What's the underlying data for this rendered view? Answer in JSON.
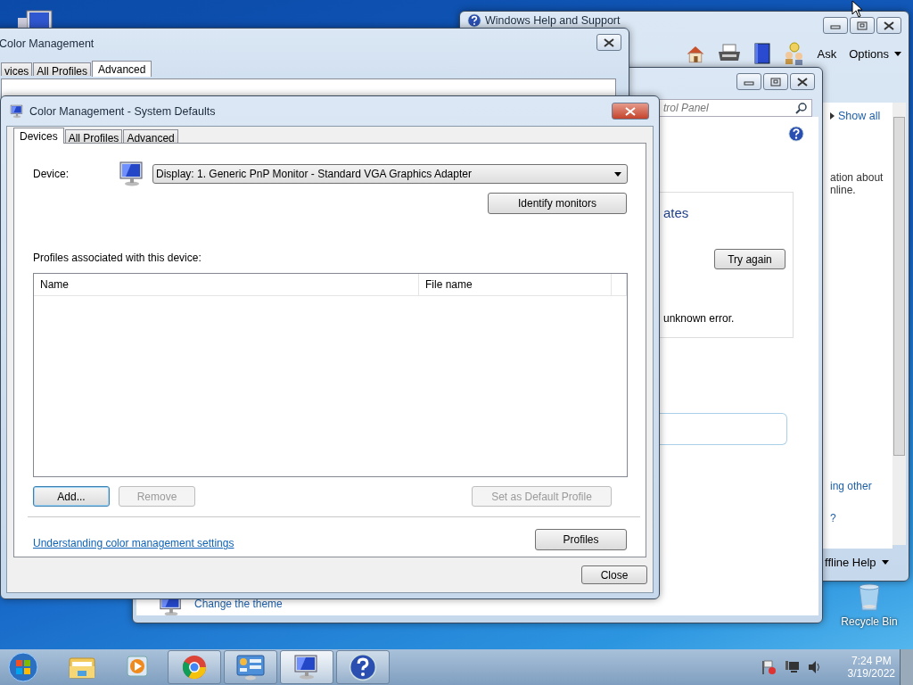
{
  "desktop": {
    "icons": [
      {
        "label": "Recycle Bin"
      }
    ]
  },
  "help_window": {
    "title": "Windows Help and Support",
    "toolbar": [
      "Ask",
      "Options"
    ],
    "show_all": "Show all",
    "text_fragments": [
      "ation about",
      "nline."
    ],
    "link_fragments": [
      "ing other",
      "?"
    ],
    "status": "ffline Help"
  },
  "control_panel": {
    "search_placeholder": "trol Panel",
    "section_heading": "ates",
    "try_again": "Try again",
    "error_text": "unknown error.",
    "item": {
      "link": "Change the theme"
    }
  },
  "back_dialog": {
    "title": "Color Management",
    "tabs": [
      {
        "label": "vices",
        "selected": false
      },
      {
        "label": "All Profiles",
        "selected": false
      },
      {
        "label": "Advanced",
        "selected": true
      }
    ]
  },
  "dialog": {
    "title": "Color Management - System Defaults",
    "tabs": [
      {
        "label": "Devices",
        "selected": true
      },
      {
        "label": "All Profiles",
        "selected": false
      },
      {
        "label": "Advanced",
        "selected": false
      }
    ],
    "device_label": "Device:",
    "device_value": "Display: 1. Generic PnP Monitor - Standard VGA Graphics Adapter",
    "identify_button": "Identify monitors",
    "profiles_label": "Profiles associated with this device:",
    "columns": [
      "Name",
      "File name"
    ],
    "buttons": [
      {
        "label": "Add...",
        "disabled": false,
        "focused": true
      },
      {
        "label": "Remove",
        "disabled": true,
        "focused": false
      },
      {
        "label": "Set as Default Profile",
        "disabled": true,
        "focused": false
      }
    ],
    "link": "Understanding color management settings",
    "profiles_button": "Profiles",
    "close_button": "Close"
  },
  "taskbar": {
    "items": [
      {
        "kind": "folder",
        "open": false,
        "active": false
      },
      {
        "kind": "media",
        "open": false,
        "active": false
      },
      {
        "kind": "browser",
        "open": true,
        "active": false
      },
      {
        "kind": "panel",
        "open": true,
        "active": false
      },
      {
        "kind": "monitor",
        "open": true,
        "active": true
      },
      {
        "kind": "help",
        "open": true,
        "active": false
      }
    ],
    "time": "7:24 PM",
    "date": "3/19/2022"
  }
}
